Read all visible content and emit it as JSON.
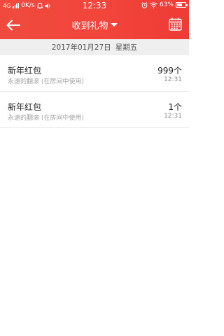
{
  "status_bar": {
    "network": "4G",
    "speed": "0K/s",
    "time": "12:33",
    "battery": "63%",
    "battery_level": 0.63
  },
  "header": {
    "title": "收到礼物",
    "accent_color": "#f0443a"
  },
  "date_bar": {
    "date": "2017年01月27日",
    "weekday": "星期五"
  },
  "gifts": [
    {
      "name": "新年红包",
      "desc": "永遠的翻滚 (在房间中使用)",
      "count": "999个",
      "time": "12:31"
    },
    {
      "name": "新年红包",
      "desc": "永遠的翻滚 (在房间中使用)",
      "count": "1个",
      "time": "12:31"
    }
  ]
}
